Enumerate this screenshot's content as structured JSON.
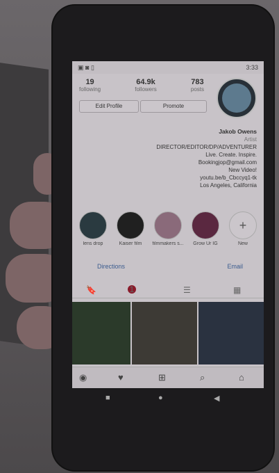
{
  "status": {
    "time": "3:33",
    "icons": "▣ ◙ ▯"
  },
  "profile": {
    "posts_count": "783",
    "posts_label": "posts",
    "followers_count": "64.9k",
    "followers_label": "followers",
    "following_count": "19",
    "following_label": "following",
    "promote_label": "Promote",
    "edit_label": "Edit Profile"
  },
  "bio": {
    "name": "Jakob Owens",
    "category": "Artist",
    "lines": [
      "DIRECTOR/EDITOR/DP/ADVENTURER",
      "Live. Create. Inspire.",
      "Bookingjop@gmail.com",
      "New Video!",
      "youtu.be/b_Cbccyq1-tk",
      "Los Angeles, California"
    ]
  },
  "highlights": [
    {
      "label": "New",
      "color": "#cbc6cb"
    },
    {
      "label": "Grow Ur IG",
      "color": "#5a2840"
    },
    {
      "label": "filmmakers s...",
      "color": "#8a6a7a"
    },
    {
      "label": "Kaiser film",
      "color": "#202020"
    },
    {
      "label": "lens drop",
      "color": "#2a3a40"
    }
  ],
  "links": {
    "email": "Email",
    "directions": "Directions"
  },
  "tabs": {
    "badge": "1"
  },
  "grid_colors": [
    "#2b3a2a",
    "#3d3a35",
    "#2a3240"
  ]
}
